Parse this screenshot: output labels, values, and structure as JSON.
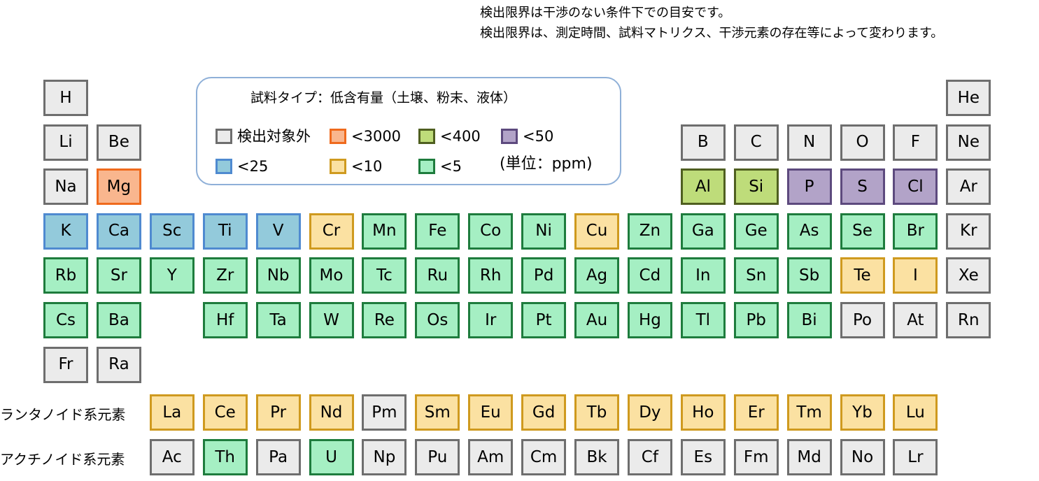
{
  "notes": {
    "line1": "検出限界は干渉のない条件下での目安です。",
    "line2": "検出限界は、測定時間、試料マトリクス、干渉元素の存在等によって変わります。"
  },
  "legend": {
    "title": "試料タイプ：低含有量（土壌、粉末、液体）",
    "unit": "(単位：ppm)",
    "items": [
      {
        "key": "none",
        "label": "検出対象外",
        "fill": "#ebebeb",
        "border": "#6e6e6e"
      },
      {
        "key": "c3000",
        "label": "<3000",
        "fill": "#f9b68e",
        "border": "#ef6a1d"
      },
      {
        "key": "c400",
        "label": "<400",
        "fill": "#bedc7a",
        "border": "#4f5f20"
      },
      {
        "key": "c50",
        "label": "<50",
        "fill": "#b2a3c8",
        "border": "#5d4a7e"
      },
      {
        "key": "c25",
        "label": "<25",
        "fill": "#93cadb",
        "border": "#4f8ad0"
      },
      {
        "key": "c10",
        "label": "<10",
        "fill": "#fbe1a2",
        "border": "#cf9a1f"
      },
      {
        "key": "c5",
        "label": "<5",
        "fill": "#a5efc3",
        "border": "#1e7c3d"
      }
    ]
  },
  "series_labels": {
    "lanthanides": "ランタノイド系元素",
    "actinides": "アクチノイド系元素"
  },
  "main_rows": [
    [
      [
        "H",
        "none"
      ],
      null,
      null,
      null,
      null,
      null,
      null,
      null,
      null,
      null,
      null,
      null,
      null,
      null,
      null,
      null,
      null,
      [
        "He",
        "none"
      ]
    ],
    [
      [
        "Li",
        "none"
      ],
      [
        "Be",
        "none"
      ],
      null,
      null,
      null,
      null,
      null,
      null,
      null,
      null,
      null,
      null,
      [
        "B",
        "none"
      ],
      [
        "C",
        "none"
      ],
      [
        "N",
        "none"
      ],
      [
        "O",
        "none"
      ],
      [
        "F",
        "none"
      ],
      [
        "Ne",
        "none"
      ]
    ],
    [
      [
        "Na",
        "none"
      ],
      [
        "Mg",
        "c3000"
      ],
      null,
      null,
      null,
      null,
      null,
      null,
      null,
      null,
      null,
      null,
      [
        "Al",
        "c400"
      ],
      [
        "Si",
        "c400"
      ],
      [
        "P",
        "c50"
      ],
      [
        "S",
        "c50"
      ],
      [
        "Cl",
        "c50"
      ],
      [
        "Ar",
        "none"
      ]
    ],
    [
      [
        "K",
        "c25"
      ],
      [
        "Ca",
        "c25"
      ],
      [
        "Sc",
        "c25"
      ],
      [
        "Ti",
        "c25"
      ],
      [
        "V",
        "c25"
      ],
      [
        "Cr",
        "c10"
      ],
      [
        "Mn",
        "c5"
      ],
      [
        "Fe",
        "c5"
      ],
      [
        "Co",
        "c5"
      ],
      [
        "Ni",
        "c5"
      ],
      [
        "Cu",
        "c10"
      ],
      [
        "Zn",
        "c5"
      ],
      [
        "Ga",
        "c5"
      ],
      [
        "Ge",
        "c5"
      ],
      [
        "As",
        "c5"
      ],
      [
        "Se",
        "c5"
      ],
      [
        "Br",
        "c5"
      ],
      [
        "Kr",
        "none"
      ]
    ],
    [
      [
        "Rb",
        "c5"
      ],
      [
        "Sr",
        "c5"
      ],
      [
        "Y",
        "c5"
      ],
      [
        "Zr",
        "c5"
      ],
      [
        "Nb",
        "c5"
      ],
      [
        "Mo",
        "c5"
      ],
      [
        "Tc",
        "c5"
      ],
      [
        "Ru",
        "c5"
      ],
      [
        "Rh",
        "c5"
      ],
      [
        "Pd",
        "c5"
      ],
      [
        "Ag",
        "c5"
      ],
      [
        "Cd",
        "c5"
      ],
      [
        "In",
        "c5"
      ],
      [
        "Sn",
        "c5"
      ],
      [
        "Sb",
        "c5"
      ],
      [
        "Te",
        "c10"
      ],
      [
        "I",
        "c10"
      ],
      [
        "Xe",
        "none"
      ]
    ],
    [
      [
        "Cs",
        "c5"
      ],
      [
        "Ba",
        "c5"
      ],
      null,
      [
        "Hf",
        "c5"
      ],
      [
        "Ta",
        "c5"
      ],
      [
        "W",
        "c5"
      ],
      [
        "Re",
        "c5"
      ],
      [
        "Os",
        "c5"
      ],
      [
        "Ir",
        "c5"
      ],
      [
        "Pt",
        "c5"
      ],
      [
        "Au",
        "c5"
      ],
      [
        "Hg",
        "c5"
      ],
      [
        "Tl",
        "c5"
      ],
      [
        "Pb",
        "c5"
      ],
      [
        "Bi",
        "c5"
      ],
      [
        "Po",
        "none"
      ],
      [
        "At",
        "none"
      ],
      [
        "Rn",
        "none"
      ]
    ],
    [
      [
        "Fr",
        "none"
      ],
      [
        "Ra",
        "none"
      ],
      null,
      null,
      null,
      null,
      null,
      null,
      null,
      null,
      null,
      null,
      null,
      null,
      null,
      null,
      null,
      null
    ]
  ],
  "lanthanides": [
    [
      "La",
      "c10"
    ],
    [
      "Ce",
      "c10"
    ],
    [
      "Pr",
      "c10"
    ],
    [
      "Nd",
      "c10"
    ],
    [
      "Pm",
      "none"
    ],
    [
      "Sm",
      "c10"
    ],
    [
      "Eu",
      "c10"
    ],
    [
      "Gd",
      "c10"
    ],
    [
      "Tb",
      "c10"
    ],
    [
      "Dy",
      "c10"
    ],
    [
      "Ho",
      "c10"
    ],
    [
      "Er",
      "c10"
    ],
    [
      "Tm",
      "c10"
    ],
    [
      "Yb",
      "c10"
    ],
    [
      "Lu",
      "c10"
    ]
  ],
  "actinides": [
    [
      "Ac",
      "none"
    ],
    [
      "Th",
      "c5"
    ],
    [
      "Pa",
      "none"
    ],
    [
      "U",
      "c5"
    ],
    [
      "Np",
      "none"
    ],
    [
      "Pu",
      "none"
    ],
    [
      "Am",
      "none"
    ],
    [
      "Cm",
      "none"
    ],
    [
      "Bk",
      "none"
    ],
    [
      "Cf",
      "none"
    ],
    [
      "Es",
      "none"
    ],
    [
      "Fm",
      "none"
    ],
    [
      "Md",
      "none"
    ],
    [
      "No",
      "none"
    ],
    [
      "Lr",
      "none"
    ]
  ]
}
